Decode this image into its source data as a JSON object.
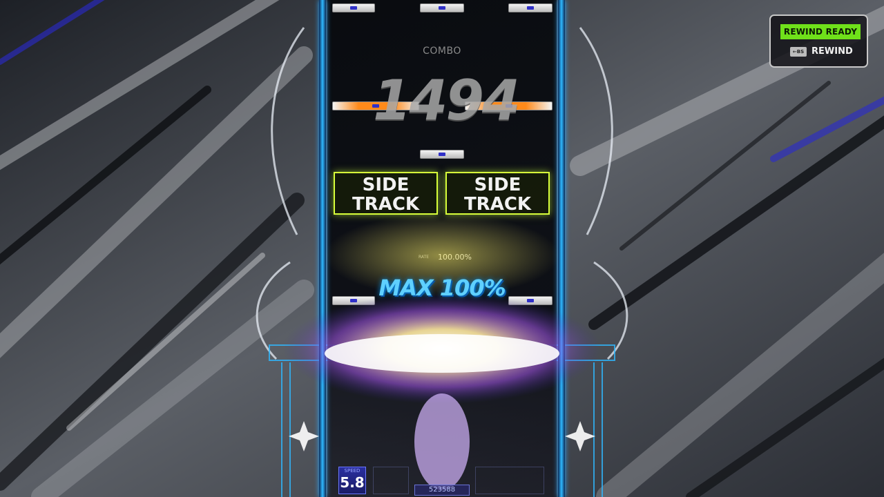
{
  "hud": {
    "combo_label": "COMBO",
    "combo_value": "1494",
    "rate_tag": "RATE",
    "rate_value": "100.00%",
    "max_rate_label": "MAX 100%",
    "speed_label": "SPEED",
    "speed_value": "5.8",
    "score": "523588"
  },
  "side_tracks": [
    {
      "line1": "SIDE",
      "line2": "TRACK"
    },
    {
      "line1": "SIDE",
      "line2": "TRACK"
    }
  ],
  "rewind": {
    "ready_label": "REWIND READY",
    "key_label": "←BS",
    "action_label": "REWIND"
  },
  "colors": {
    "rewind_ready": "#6fe11a",
    "side_track_border": "#d8ff3a",
    "frame_glow": "#2fb8ff",
    "max_rate_text": "#5fd0ff",
    "note_accent": "#ff8a1a"
  }
}
